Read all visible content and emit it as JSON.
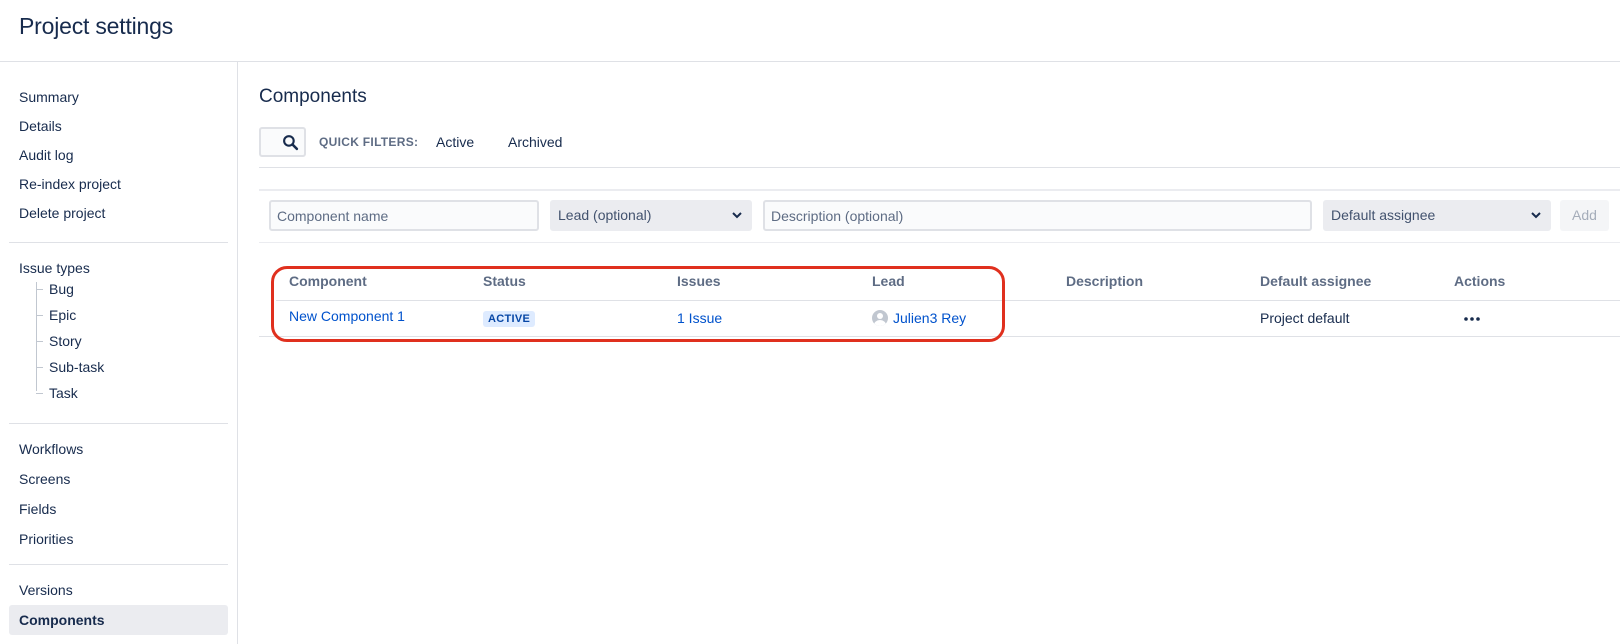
{
  "header": {
    "title": "Project settings"
  },
  "sidebar": {
    "group1": [
      "Summary",
      "Details",
      "Audit log",
      "Re-index project",
      "Delete project"
    ],
    "issue_types": {
      "heading": "Issue types",
      "items": [
        "Bug",
        "Epic",
        "Story",
        "Sub-task",
        "Task"
      ]
    },
    "group3": [
      "Workflows",
      "Screens",
      "Fields",
      "Priorities"
    ],
    "group4": [
      "Versions",
      "Components"
    ],
    "selected": "Components"
  },
  "main": {
    "title": "Components",
    "quick_filters": {
      "label": "QUICK FILTERS:",
      "active": "Active",
      "archived": "Archived"
    },
    "create_form": {
      "name_placeholder": "Component name",
      "lead_placeholder": "Lead (optional)",
      "description_placeholder": "Description (optional)",
      "assignee_placeholder": "Default assignee",
      "add_label": "Add"
    },
    "table": {
      "headers": [
        "Component",
        "Status",
        "Issues",
        "Lead",
        "Description",
        "Default assignee",
        "Actions"
      ],
      "rows": [
        {
          "component": "New Component 1",
          "status": "ACTIVE",
          "issues": "1 Issue",
          "lead": "Julien3 Rey",
          "description": "",
          "default_assignee": "Project default",
          "actions_icon": "more-icon"
        }
      ]
    }
  },
  "colors": {
    "link": "#0052cc",
    "highlight": "#e0301e",
    "lozenge_bg": "#deebff"
  }
}
